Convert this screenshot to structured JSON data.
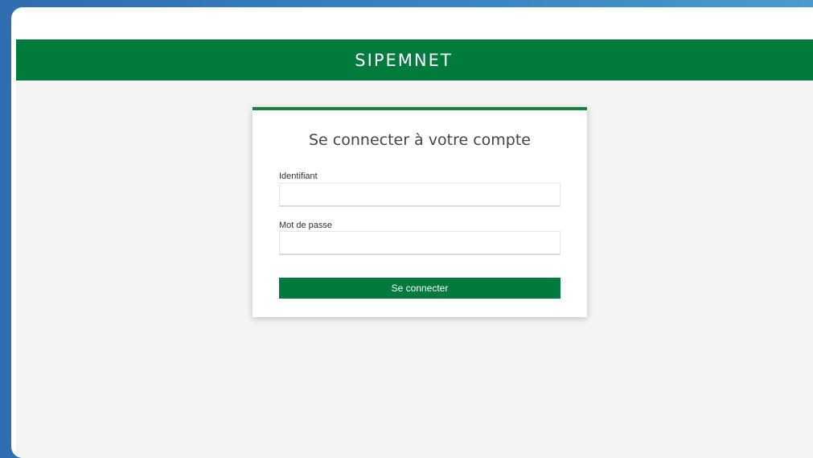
{
  "header": {
    "brand": "SIPEMNET"
  },
  "login": {
    "title": "Se connecter à votre compte",
    "username": {
      "label": "Identifiant",
      "value": "",
      "placeholder": ""
    },
    "password": {
      "label": "Mot de passe",
      "value": "",
      "placeholder": ""
    },
    "submit_label": "Se connecter"
  },
  "colors": {
    "accent": "#007a3d",
    "page_background": "#f4f4f4",
    "outer_background": "#3a86c2"
  }
}
